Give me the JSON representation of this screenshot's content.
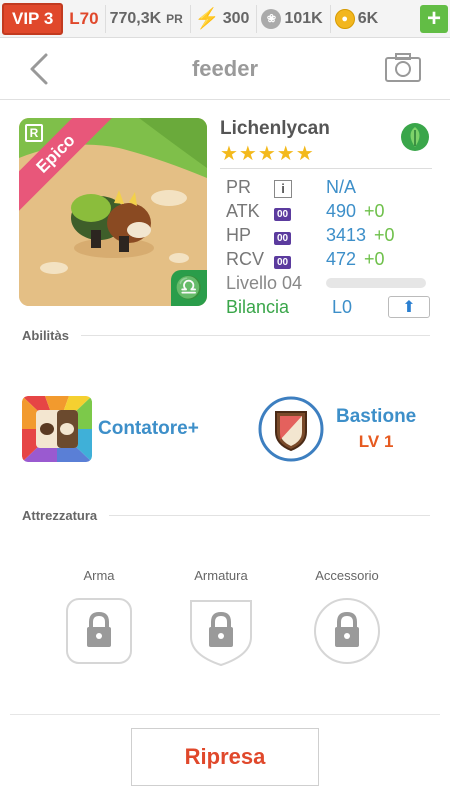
{
  "topbar": {
    "vip": "VIP 3",
    "level": "L70",
    "pr_value": "770,3K",
    "pr_unit": "PR",
    "energy": "300",
    "food": "101K",
    "gold": "6K",
    "plus": "+"
  },
  "header": {
    "title": "feeder"
  },
  "monster": {
    "name": "Lichenlycan",
    "rarity": "Epico",
    "rank_badge": "R",
    "stars": 5,
    "stars_text": "★★★★★",
    "element": "leaf-icon",
    "stats": [
      {
        "label": "PR",
        "badge": "i",
        "value": "N/A",
        "bonus": ""
      },
      {
        "label": "ATK",
        "badge": "00",
        "value": "490",
        "bonus": "+0"
      },
      {
        "label": "HP",
        "badge": "00",
        "value": "3413",
        "bonus": "+0"
      },
      {
        "label": "RCV",
        "badge": "00",
        "value": "472",
        "bonus": "+0"
      }
    ],
    "level_label": "Livello 04",
    "level_progress": 0,
    "balance_label": "Bilancia",
    "balance_value": "L0"
  },
  "abilities": {
    "header": "Abilitàs",
    "items": [
      {
        "name": "Contatore+",
        "level": ""
      },
      {
        "name": "Bastione",
        "level": "LV 1"
      }
    ]
  },
  "equipment": {
    "header": "Attrezzatura",
    "slots": [
      {
        "label": "Arma"
      },
      {
        "label": "Armatura"
      },
      {
        "label": "Accessorio"
      }
    ]
  },
  "footer": {
    "button": "Ripresa"
  },
  "colors": {
    "accent_red": "#e0482b",
    "link_blue": "#3d8fc9",
    "bonus_green": "#6ec04a",
    "star_gold": "#f3b91c",
    "rarity_pink": "#e8577a"
  }
}
